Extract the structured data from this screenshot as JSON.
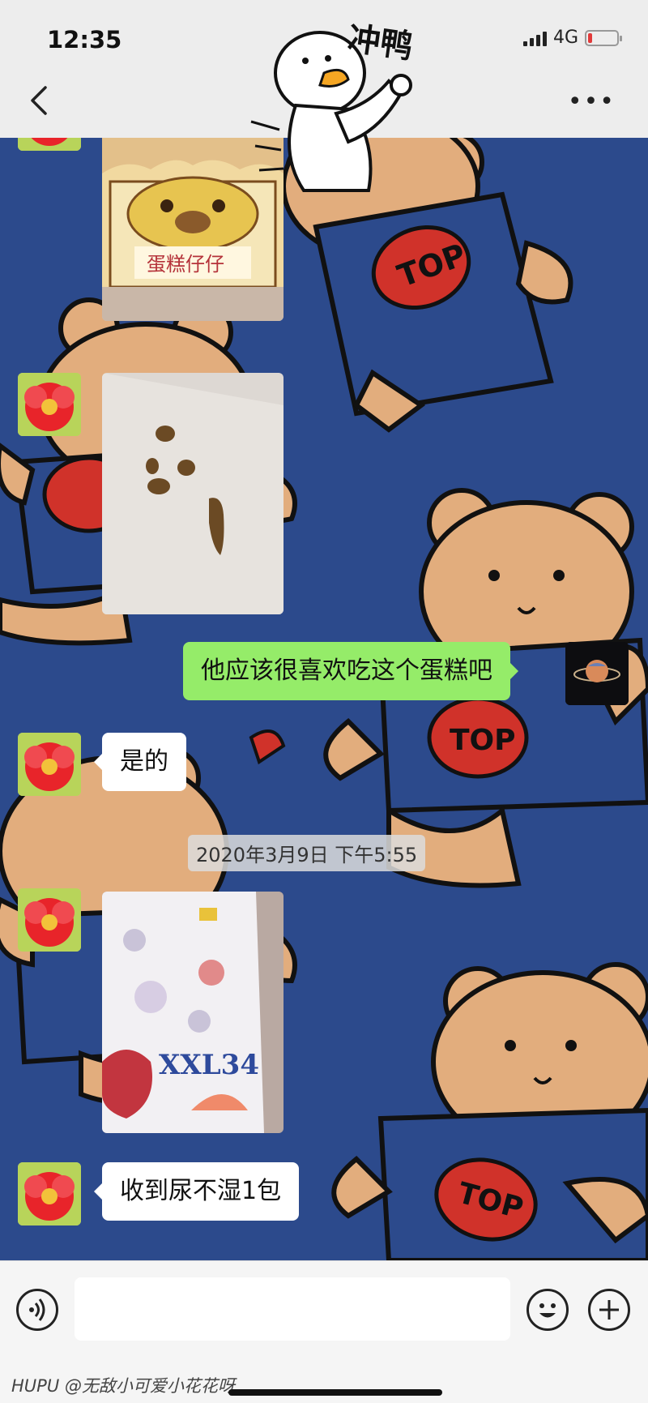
{
  "status_bar": {
    "time": "12:35",
    "network": "4G",
    "battery_low_color": "#e23a3a"
  },
  "header": {
    "back_icon": "chevron-left-icon",
    "more_icon": "more-dots-icon",
    "more_label": "•••"
  },
  "sticker": {
    "text": "冲鸭",
    "icon": "duck-sticker"
  },
  "messages": [
    {
      "side": "left",
      "type": "image",
      "desc_icon": "cake-box-photo"
    },
    {
      "side": "left",
      "type": "image",
      "desc_icon": "droppings-photo"
    },
    {
      "side": "right",
      "type": "text",
      "text": "他应该很喜欢吃这个蛋糕吧"
    },
    {
      "side": "left",
      "type": "text",
      "text": "是的"
    },
    {
      "side": "left",
      "type": "image",
      "desc_icon": "diaper-pack-photo",
      "label": "XXL34"
    },
    {
      "side": "left",
      "type": "text",
      "text": "收到尿不湿1包"
    }
  ],
  "timestamp": "2020年3月9日 下午5:55",
  "photo_texts": {
    "cake_box": "蛋糕仔仔",
    "diaper_size": "XXL34"
  },
  "background_text": "TOP",
  "inputbar": {
    "voice_icon": "voice-icon",
    "emoji_icon": "emoji-icon",
    "plus_icon": "plus-icon"
  },
  "watermark": "HUPU @无敌小可爱小花花呀",
  "colors": {
    "chat_bg": "#2c4a8c",
    "bear": "#e2ad7d",
    "sent_bubble": "#95ec69",
    "received_bubble": "#ffffff"
  }
}
